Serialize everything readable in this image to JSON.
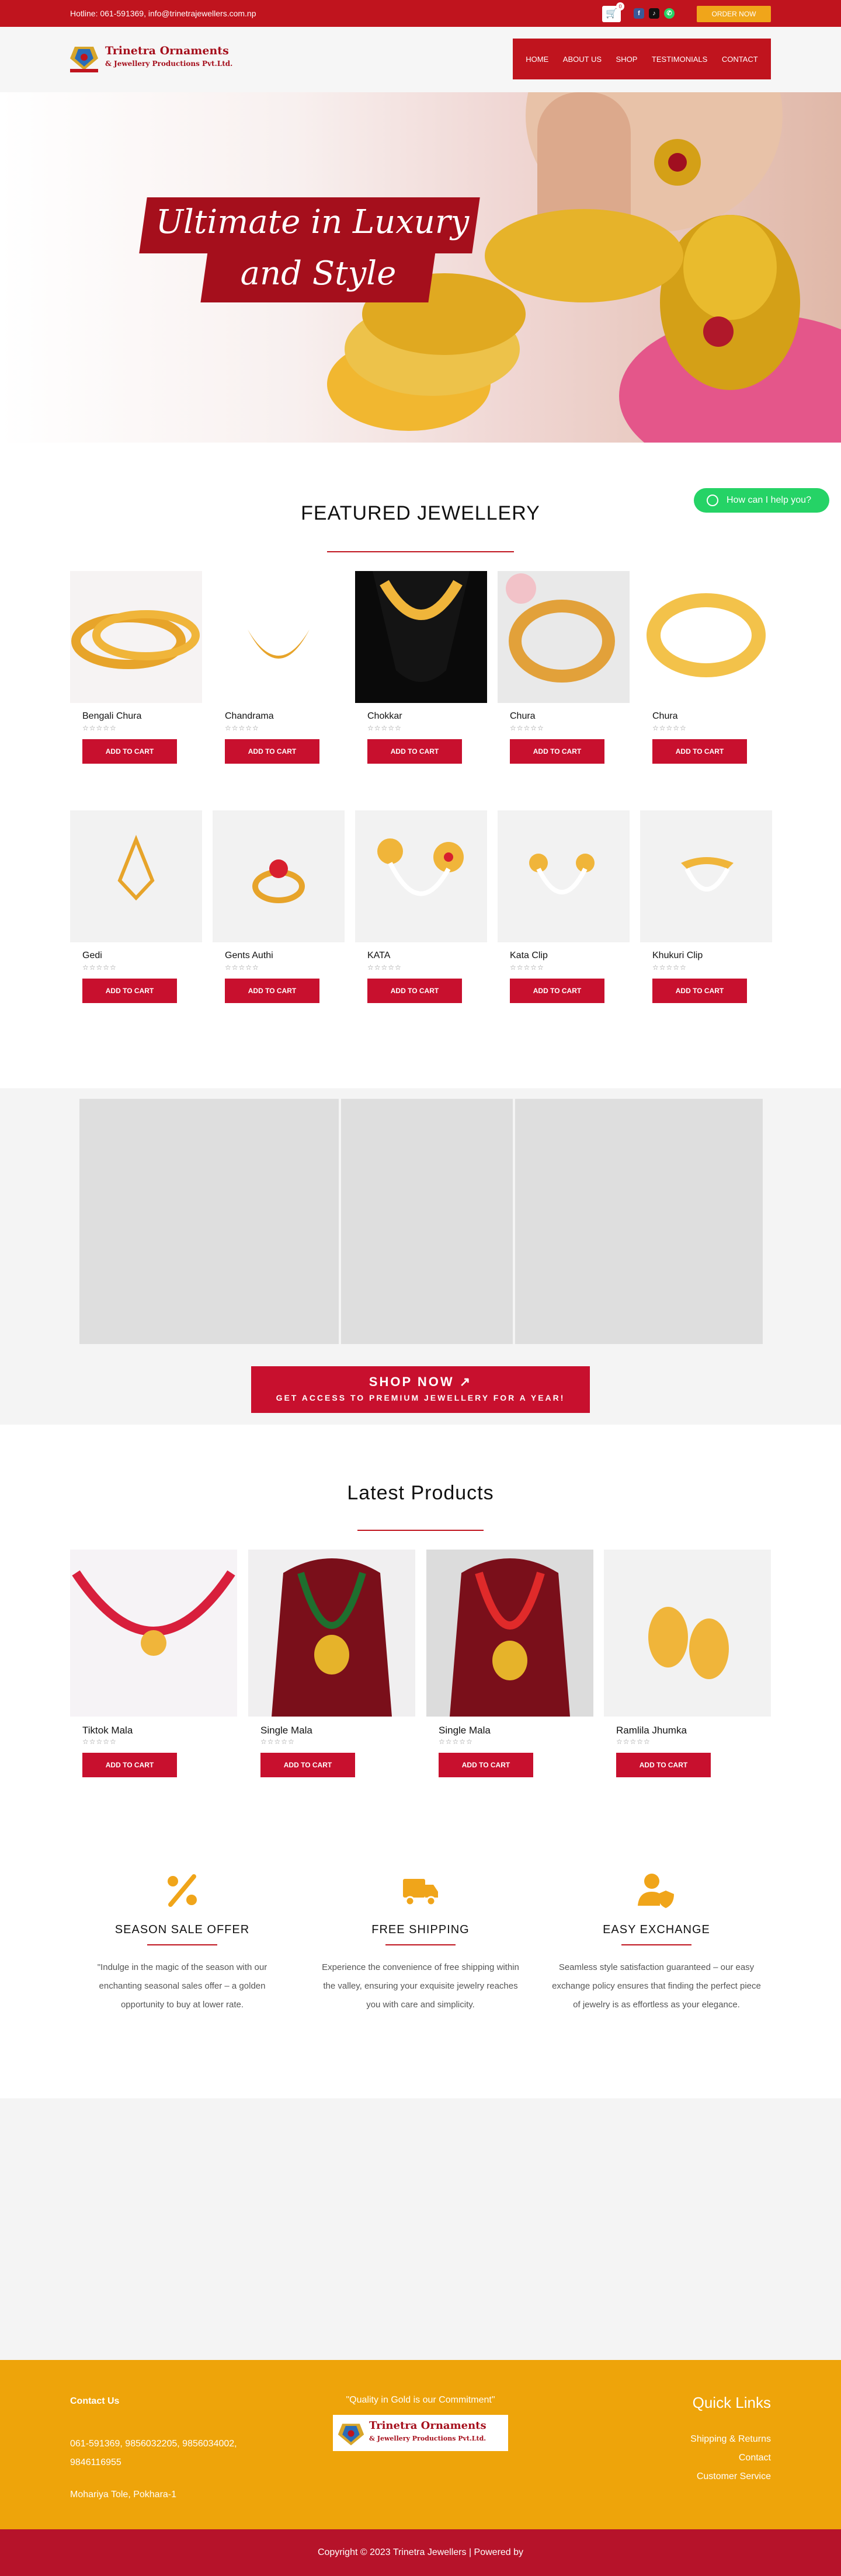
{
  "topbar": {
    "hotline": "Hotline: 061-591369, info@trinetrajewellers.com.np",
    "cart_count": "0",
    "order_label": "ORDER NOW",
    "brand_color": "#c0141e",
    "accent_color": "#f0a51a"
  },
  "logo": {
    "line1": "Trinetra Ornaments",
    "line2": "& Jewellery Productions Pvt.Ltd."
  },
  "nav": {
    "items": [
      "HOME",
      "ABOUT US",
      "SHOP",
      "TESTIMONIALS",
      "CONTACT"
    ]
  },
  "hero": {
    "line1": "Ultimate in Luxury",
    "line2": "and Style"
  },
  "featured": {
    "title": "FEATURED JEWELLERY",
    "add_label": "ADD TO CART",
    "products": [
      {
        "name": "Bengali Chura"
      },
      {
        "name": "Chandrama"
      },
      {
        "name": "Chokkar"
      },
      {
        "name": "Chura"
      },
      {
        "name": "Chura"
      },
      {
        "name": "Gedi"
      },
      {
        "name": "Gents Authi"
      },
      {
        "name": "KATA"
      },
      {
        "name": "Kata Clip"
      },
      {
        "name": "Khukuri Clip"
      }
    ]
  },
  "whatsapp": {
    "label": "How can I help you?"
  },
  "shop_now": {
    "title": "SHOP NOW",
    "subtitle": "GET ACCESS TO PREMIUM JEWELLERY FOR A YEAR!"
  },
  "latest": {
    "title": "Latest Products",
    "add_label": "ADD TO CART",
    "products": [
      {
        "name": "Tiktok Mala"
      },
      {
        "name": "Single Mala"
      },
      {
        "name": "Single Mala"
      },
      {
        "name": "Ramlila Jhumka"
      }
    ]
  },
  "features": [
    {
      "title": "SEASON SALE OFFER",
      "text": "\"Indulge in the magic of the season with our enchanting seasonal sales offer – a golden opportunity to buy at lower rate.",
      "icon": "percent-icon"
    },
    {
      "title": "FREE SHIPPING",
      "text": "Experience the convenience of free shipping within the valley, ensuring your exquisite jewelry reaches you with care and simplicity.",
      "icon": "truck-icon"
    },
    {
      "title": "EASY EXCHANGE",
      "text": "Seamless style satisfaction guaranteed – our easy exchange policy ensures that finding the perfect piece of jewelry is as effortless as your elegance.",
      "icon": "user-shield-icon"
    }
  ],
  "footer": {
    "contact_heading": "Contact Us",
    "phones": "061-591369, 9856032205, 9856034002, 9846116955",
    "address": "Mohariya Tole, Pokhara-1",
    "quote": "\"Quality in Gold is our Commitment\"",
    "quick_links_heading": "Quick Links",
    "links": [
      "Shipping & Returns",
      "Contact",
      "Customer Service"
    ],
    "copyright": "Copyright © 2023 Trinetra Jewellers | Powered by",
    "footer_color": "#eea40a"
  }
}
